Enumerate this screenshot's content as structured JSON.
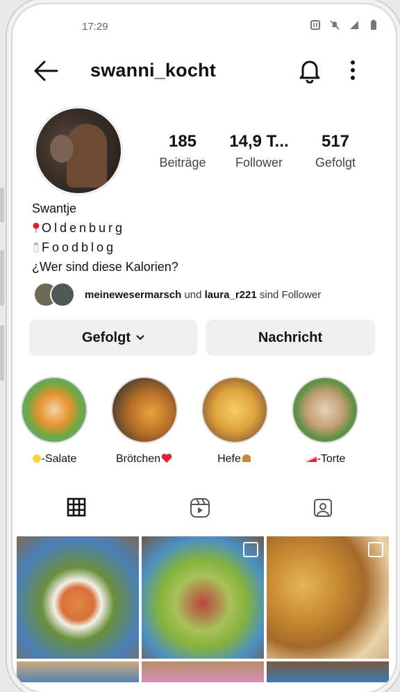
{
  "status": {
    "time": "17:29"
  },
  "header": {
    "username": "swanni_kocht"
  },
  "stats": [
    {
      "value": "185",
      "label": "Beiträge"
    },
    {
      "value": "14,9 T...",
      "label": "Follower"
    },
    {
      "value": "517",
      "label": "Gefolgt"
    }
  ],
  "bio": {
    "name": "Swantje",
    "location": "Oldenburg",
    "category": "Foodblog",
    "tagline": "¿Wer sind diese Kalorien?"
  },
  "followed_by": {
    "user1": "meinewesermarsch",
    "connector": "und",
    "user2": "laura_r221",
    "suffix": "sind Follower"
  },
  "buttons": {
    "following": "Gefolgt",
    "message": "Nachricht"
  },
  "highlights": [
    {
      "label": "-Salate",
      "emoji": "yellow-circle"
    },
    {
      "label": "Brötchen",
      "emoji": "red-heart"
    },
    {
      "label": "Hefe",
      "emoji": "bread"
    },
    {
      "label": "-Torte",
      "emoji": "cake-slice"
    }
  ],
  "tabs": [
    {
      "icon": "grid-icon"
    },
    {
      "icon": "reels-icon"
    },
    {
      "icon": "tagged-icon"
    }
  ],
  "posts": [
    {
      "desc": "bowl with salmon, egg, broccoli",
      "multi": false
    },
    {
      "desc": "avocado salad with meat",
      "multi": true
    },
    {
      "desc": "baked buns",
      "multi": true
    }
  ],
  "colors": {
    "text": "#111111",
    "button_bg": "#efefef",
    "accent_heart": "#e0242f"
  }
}
